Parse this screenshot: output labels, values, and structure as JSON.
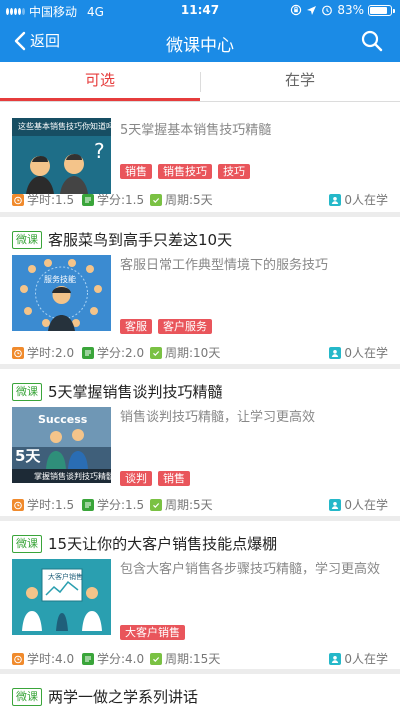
{
  "status_bar": {
    "carrier": "中国移动",
    "network": "4G",
    "time": "11:47",
    "battery": "83%",
    "battery_level": 0.83
  },
  "nav": {
    "back_label": "返回",
    "title": "微课中心"
  },
  "tabs": [
    {
      "label": "可选"
    },
    {
      "label": "在学"
    }
  ],
  "courses": [
    {
      "title": "5天掌握基本销售技巧精髓",
      "description": "5天掌握基本销售技巧精髓",
      "thumb_text": "这些基本销售技巧你知道吗",
      "tags": [
        "销售",
        "销售技巧",
        "技巧"
      ],
      "hours": "学时:1.5",
      "credits": "学分:1.5",
      "period": "周期:5天",
      "learners": "0人在学"
    },
    {
      "badge": "微课",
      "title": "客服菜鸟到高手只差这10天",
      "description": "客服日常工作典型情境下的服务技巧",
      "thumb_text": "服务技能",
      "tags": [
        "客服",
        "客户服务"
      ],
      "hours": "学时:2.0",
      "credits": "学分:2.0",
      "period": "周期:10天",
      "learners": "0人在学"
    },
    {
      "badge": "微课",
      "title": "5天掌握销售谈判技巧精髓",
      "description": "销售谈判技巧精髓，让学习更高效",
      "thumb_text": "Success",
      "thumb_big": "5天",
      "thumb_caption": "掌握销售谈判技巧精髓",
      "tags": [
        "谈判",
        "销售"
      ],
      "hours": "学时:1.5",
      "credits": "学分:1.5",
      "period": "周期:5天",
      "learners": "0人在学"
    },
    {
      "badge": "微课",
      "title": "15天让你的大客户销售技能点爆棚",
      "description": "包含大客户销售各步骤技巧精髓，学习更高效",
      "thumb_text": "大客户销售",
      "tags": [
        "大客户销售"
      ],
      "hours": "学时:4.0",
      "credits": "学分:4.0",
      "period": "周期:15天",
      "learners": "0人在学"
    },
    {
      "badge": "微课",
      "title": "两学一做之学系列讲话"
    }
  ],
  "colors": {
    "primary": "#1b8be6",
    "accent_red": "#e63c3c",
    "tag_bg": "#e9555b",
    "badge_green": "#3aa53a"
  }
}
